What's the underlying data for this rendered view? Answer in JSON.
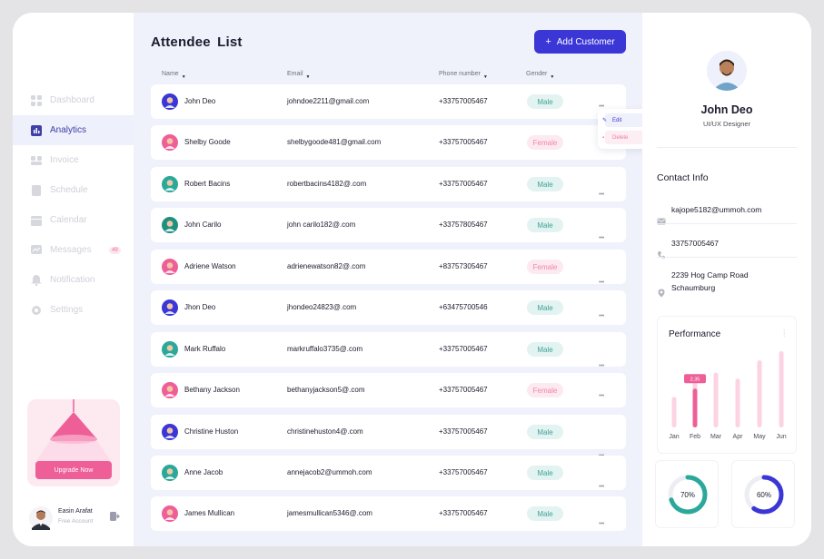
{
  "sidebar": {
    "items": [
      {
        "label": "Dashboard",
        "icon": "dashboard-icon",
        "active": false
      },
      {
        "label": "Analytics",
        "icon": "analytics-icon",
        "active": true
      },
      {
        "label": "Invoice",
        "icon": "invoice-icon",
        "active": false
      },
      {
        "label": "Schedule",
        "icon": "schedule-icon",
        "active": false
      },
      {
        "label": "Calendar",
        "icon": "calendar-icon",
        "active": false
      },
      {
        "label": "Messages",
        "icon": "messages-icon",
        "active": false,
        "badge": "49"
      },
      {
        "label": "Notification",
        "icon": "notification-icon",
        "active": false
      },
      {
        "label": "Settings",
        "icon": "settings-icon",
        "active": false
      }
    ],
    "upgrade_label": "Upgrade Now",
    "user": {
      "name": "Easin Arafat",
      "role": "Free Account"
    }
  },
  "main": {
    "title": "Attendee  List",
    "add_button": "Add Customer",
    "columns": {
      "name": "Name",
      "email": "Email",
      "phone": "Phone number",
      "gender": "Gender"
    },
    "rows": [
      {
        "name": "John Deo",
        "email": "johndoe2211@gmail.com",
        "phone": "+33757005467",
        "gender": "Male"
      },
      {
        "name": "Shelby Goode",
        "email": "shelbygoode481@gmail.com",
        "phone": "+33757005467",
        "gender": "Female"
      },
      {
        "name": "Robert Bacins",
        "email": "robertbacins4182@.com",
        "phone": "+33757005467",
        "gender": "Male"
      },
      {
        "name": "John Carilo",
        "email": "john carilo182@.com",
        "phone": "+33757805467",
        "gender": "Male"
      },
      {
        "name": "Adriene Watson",
        "email": "adrienewatson82@.com",
        "phone": "+83757305467",
        "gender": "Female"
      },
      {
        "name": "Jhon Deo",
        "email": "jhondeo24823@.com",
        "phone": "+63475700546",
        "gender": "Male"
      },
      {
        "name": "Mark Ruffalo",
        "email": "markruffalo3735@.com",
        "phone": "+33757005467",
        "gender": "Male"
      },
      {
        "name": "Bethany Jackson",
        "email": "bethanyjackson5@.com",
        "phone": "+33757005467",
        "gender": "Female"
      },
      {
        "name": "Christine Huston",
        "email": "christinehuston4@.com",
        "phone": "+33757005467",
        "gender": "Male"
      },
      {
        "name": "Anne Jacob",
        "email": "annejacob2@ummoh.com",
        "phone": "+33757005467",
        "gender": "Male"
      },
      {
        "name": "James Mullican",
        "email": "jamesmullican5346@.com",
        "phone": "+33757005467",
        "gender": "Male"
      }
    ],
    "row_menu": {
      "edit": "Edit",
      "delete": "Delete"
    }
  },
  "profile": {
    "name": "John Deo",
    "role": "UI/UX Designer",
    "contact_title": "Contact Info",
    "email": "kajope5182@ummoh.com",
    "phone": "33757005467",
    "address_line1": "2239  Hog Camp Road",
    "address_line2": "Schaumburg"
  },
  "performance": {
    "title": "Performance",
    "tooltip": "2.35",
    "months": [
      "Jan",
      "Feb",
      "Mar",
      "Apr",
      "May",
      "Jun"
    ],
    "bars": [
      {
        "bg": 0.4,
        "fg": 0.0
      },
      {
        "bg": 0.62,
        "fg": 0.62
      },
      {
        "bg": 0.72,
        "fg": 0.0
      },
      {
        "bg": 0.64,
        "fg": 0.0
      },
      {
        "bg": 0.88,
        "fg": 0.0
      },
      {
        "bg": 1.0,
        "fg": 0.0
      }
    ],
    "highlight_month": "Feb"
  },
  "donuts": [
    {
      "value": 70,
      "label": "70%",
      "color": "#2aa89a"
    },
    {
      "value": 60,
      "label": "60%",
      "color": "#3b36d6"
    }
  ],
  "colors": {
    "accent": "#3b36d6",
    "pink": "#ee5f98",
    "teal": "#3fa398"
  }
}
